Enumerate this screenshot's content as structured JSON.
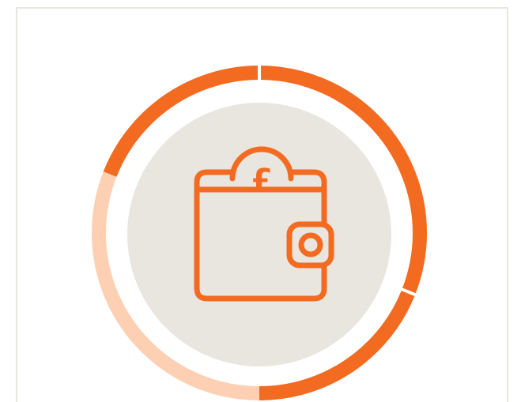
{
  "colors": {
    "ring_filled": "#f26b21",
    "ring_remaining": "#fdd0b3",
    "inner_disc": "#e8e6df",
    "icon_stroke": "#f26b21",
    "card_border": "#e8e6df",
    "background": "#ffffff"
  },
  "progress": {
    "fraction": 0.69
  },
  "icon": {
    "name": "wallet-with-pound-coin-icon",
    "currency_symbol": "£"
  }
}
